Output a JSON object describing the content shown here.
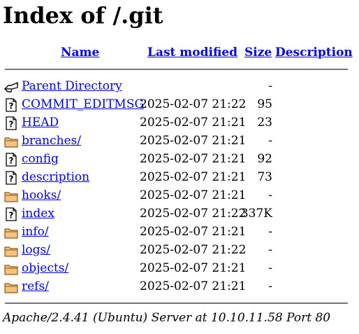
{
  "title": "Index of /.git",
  "columns": {
    "name": "Name",
    "last_modified": "Last modified",
    "size": "Size",
    "description": "Description"
  },
  "rows": [
    {
      "icon": "back-icon",
      "name": "Parent Directory",
      "date": "",
      "size": "-"
    },
    {
      "icon": "unknown-file-icon",
      "name": "COMMIT_EDITMSG",
      "date": "2025-02-07 21:22",
      "size": "95"
    },
    {
      "icon": "unknown-file-icon",
      "name": "HEAD",
      "date": "2025-02-07 21:21",
      "size": "23"
    },
    {
      "icon": "folder-icon",
      "name": "branches/",
      "date": "2025-02-07 21:21",
      "size": "-"
    },
    {
      "icon": "unknown-file-icon",
      "name": "config",
      "date": "2025-02-07 21:21",
      "size": "92"
    },
    {
      "icon": "unknown-file-icon",
      "name": "description",
      "date": "2025-02-07 21:21",
      "size": "73"
    },
    {
      "icon": "folder-icon",
      "name": "hooks/",
      "date": "2025-02-07 21:21",
      "size": "-"
    },
    {
      "icon": "unknown-file-icon",
      "name": "index",
      "date": "2025-02-07 21:22",
      "size": "337K"
    },
    {
      "icon": "folder-icon",
      "name": "info/",
      "date": "2025-02-07 21:21",
      "size": "-"
    },
    {
      "icon": "folder-icon",
      "name": "logs/",
      "date": "2025-02-07 21:22",
      "size": "-"
    },
    {
      "icon": "folder-icon",
      "name": "objects/",
      "date": "2025-02-07 21:21",
      "size": "-"
    },
    {
      "icon": "folder-icon",
      "name": "refs/",
      "date": "2025-02-07 21:21",
      "size": "-"
    }
  ],
  "footer": "Apache/2.4.41 (Ubuntu) Server at 10.10.11.58 Port 80"
}
